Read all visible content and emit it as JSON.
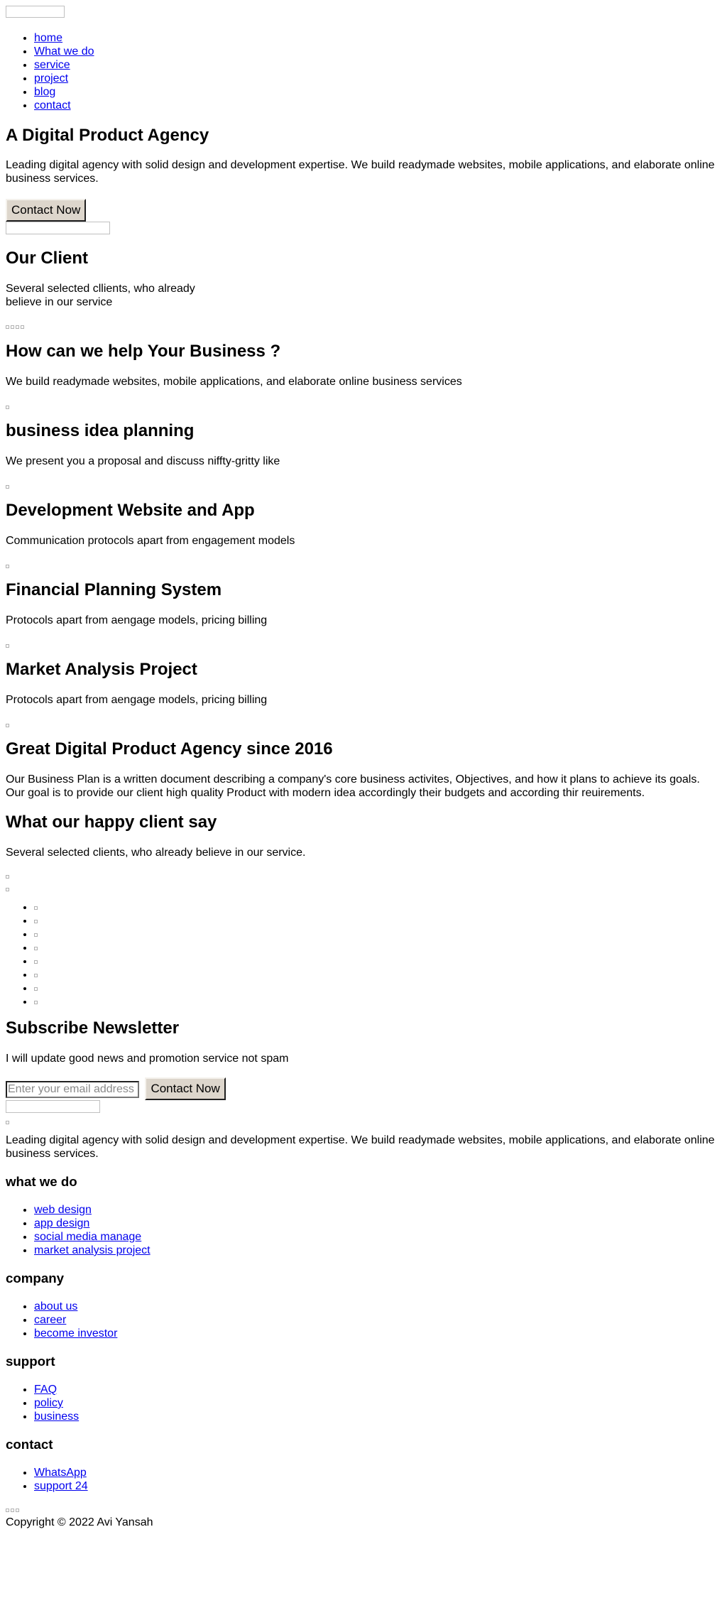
{
  "nav": {
    "items": [
      "home",
      "What we do",
      "service",
      "project",
      "blog",
      "contact"
    ]
  },
  "hero": {
    "title": "A Digital Product Agency",
    "text": "Leading digital agency with solid design and development expertise. We build readymade websites, mobile applications, and elaborate online business services.",
    "button": "Contact Now"
  },
  "clients": {
    "title": "Our Client",
    "line1": "Several selected cllients, who already",
    "line2": "believe in our service"
  },
  "help": {
    "title": "How can we help Your Business ?",
    "text": "We build readymade websites, mobile applications, and elaborate online business services"
  },
  "services": [
    {
      "title": "business idea planning",
      "text": "We present you a proposal and discuss niffty-gritty like"
    },
    {
      "title": "Development Website and App",
      "text": "Communication protocols apart from engagement models"
    },
    {
      "title": "Financial Planning System",
      "text": "Protocols apart from aengage models, pricing billing"
    },
    {
      "title": "Market Analysis Project",
      "text": "Protocols apart from aengage models, pricing billing"
    }
  ],
  "about": {
    "title": "Great Digital Product Agency since 2016",
    "text": "Our Business Plan is a written document describing a company's core business activites, Objectives, and how it plans to achieve its goals. Our goal is to provide our client high quality Product with modern idea accordingly their budgets and according thir reuirements."
  },
  "testimonials": {
    "title": "What our happy client say",
    "text": "Several selected clients, who already believe in our service."
  },
  "newsletter": {
    "title": "Subscribe Newsletter",
    "text": "I will update good news and promotion service not spam",
    "placeholder": "Enter your email address",
    "button": "Contact Now"
  },
  "footer": {
    "text": "Leading digital agency with solid design and development expertise. We build readymade websites, mobile applications, and elaborate online business services.",
    "whatwedo": {
      "title": "what we do",
      "links": [
        "web design",
        "app design",
        "social media manage",
        "market analysis project"
      ]
    },
    "company": {
      "title": "company",
      "links": [
        "about us",
        "career",
        "become investor"
      ]
    },
    "support": {
      "title": "support",
      "links": [
        "FAQ",
        "policy",
        "business"
      ]
    },
    "contact": {
      "title": "contact",
      "links": [
        "WhatsApp",
        "support 24"
      ]
    },
    "copyright": "Copyright © 2022 Avi Yansah"
  },
  "colors": {
    "link": "#0000ee",
    "button_bg": "#ddd6cc"
  }
}
